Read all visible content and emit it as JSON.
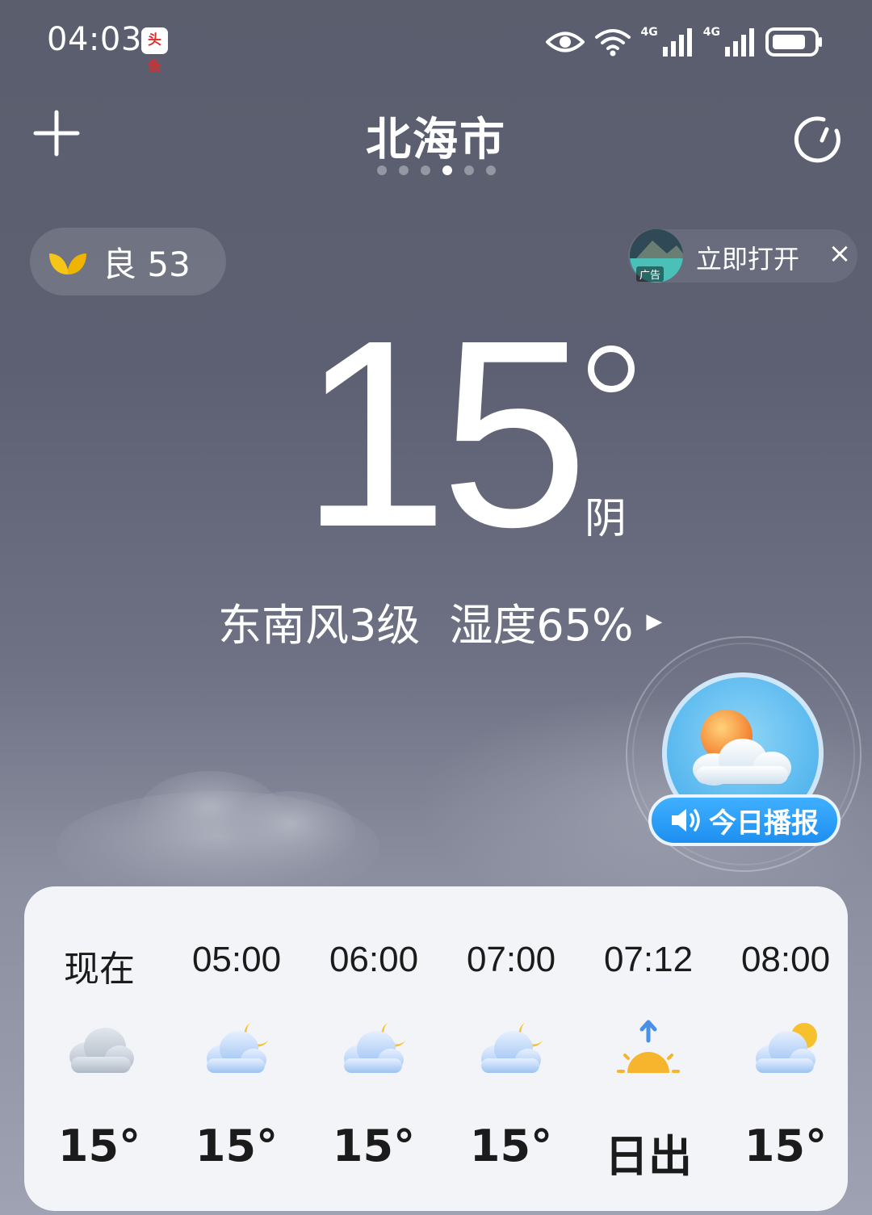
{
  "status_bar": {
    "time": "04:03",
    "news_badge": "头条",
    "network_1": "4G",
    "network_2": "4G",
    "icons": [
      "eye-icon",
      "wifi-icon",
      "signal-icon",
      "signal-icon",
      "battery-icon"
    ]
  },
  "header": {
    "city": "北海市",
    "page_count": 6,
    "active_page": 4
  },
  "aqi": {
    "label": "良 53",
    "color": "#f5c518"
  },
  "ad": {
    "tag": "广告",
    "label": "立即打开",
    "close": "×"
  },
  "current": {
    "temperature": "15",
    "condition": "阴",
    "wind": "东南风3级",
    "humidity": "湿度65%"
  },
  "broadcast": {
    "label": "今日播报",
    "accent": "#1e8ff0"
  },
  "hourly": [
    {
      "time": "现在",
      "icon": "cloudy-icon",
      "temp": "15°"
    },
    {
      "time": "05:00",
      "icon": "cloudy-night-icon",
      "temp": "15°"
    },
    {
      "time": "06:00",
      "icon": "cloudy-night-icon",
      "temp": "15°"
    },
    {
      "time": "07:00",
      "icon": "cloudy-night-icon",
      "temp": "15°"
    },
    {
      "time": "07:12",
      "icon": "sunrise-icon",
      "temp": "日出"
    },
    {
      "time": "08:00",
      "icon": "partly-cloudy-icon",
      "temp": "15°"
    }
  ]
}
